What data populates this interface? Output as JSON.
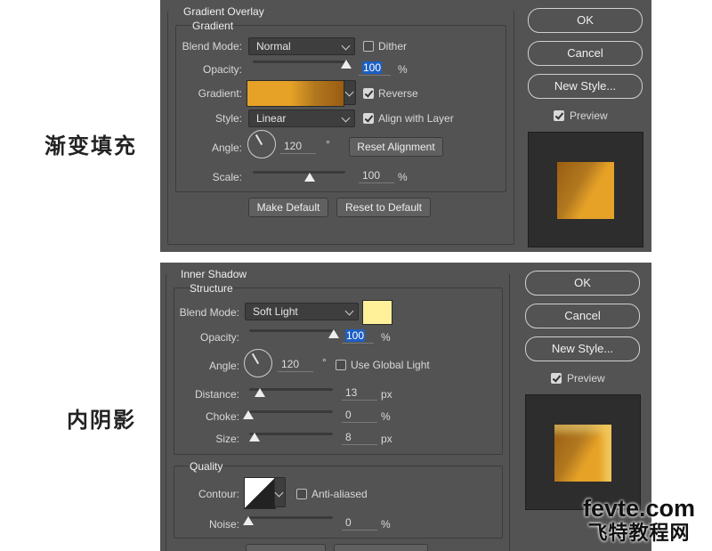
{
  "left_captions": {
    "gradient_overlay": "渐变填充",
    "inner_shadow": "内阴影"
  },
  "gradient_overlay": {
    "title": "Gradient Overlay",
    "group": "Gradient",
    "blend_mode_label": "Blend Mode:",
    "blend_mode_value": "Normal",
    "dither_label": "Dither",
    "dither_checked": false,
    "opacity_label": "Opacity:",
    "opacity_value": "100",
    "opacity_unit": "%",
    "gradient_label": "Gradient:",
    "reverse_label": "Reverse",
    "reverse_checked": true,
    "style_label": "Style:",
    "style_value": "Linear",
    "align_label": "Align with Layer",
    "align_checked": true,
    "angle_label": "Angle:",
    "angle_value": "120",
    "angle_unit": "°",
    "reset_alignment_button": "Reset Alignment",
    "scale_label": "Scale:",
    "scale_value": "100",
    "scale_unit": "%",
    "make_default_button": "Make Default",
    "reset_default_button": "Reset to Default",
    "ok_button": "OK",
    "cancel_button": "Cancel",
    "new_style_button": "New Style...",
    "preview_label": "Preview",
    "preview_checked": true,
    "colors": {
      "gradient_start": "#e6a227",
      "gradient_end": "#9a5d12"
    }
  },
  "inner_shadow": {
    "title": "Inner Shadow",
    "group": "Structure",
    "blend_mode_label": "Blend Mode:",
    "blend_mode_value": "Soft Light",
    "swatch_color": "#fff19a",
    "opacity_label": "Opacity:",
    "opacity_value": "100",
    "opacity_unit": "%",
    "angle_label": "Angle:",
    "angle_value": "120",
    "angle_unit": "°",
    "global_light_label": "Use Global Light",
    "global_light_checked": false,
    "distance_label": "Distance:",
    "distance_value": "13",
    "distance_unit": "px",
    "choke_label": "Choke:",
    "choke_value": "0",
    "choke_unit": "%",
    "size_label": "Size:",
    "size_value": "8",
    "size_unit": "px",
    "quality_group": "Quality",
    "contour_label": "Contour:",
    "anti_aliased_label": "Anti-aliased",
    "anti_aliased_checked": false,
    "noise_label": "Noise:",
    "noise_value": "0",
    "noise_unit": "%",
    "ok_button": "OK",
    "cancel_button": "Cancel",
    "new_style_button": "New Style...",
    "preview_label": "Preview",
    "preview_checked": true
  },
  "watermark": {
    "line1": "fevte.com",
    "line2": "飞特教程网"
  }
}
